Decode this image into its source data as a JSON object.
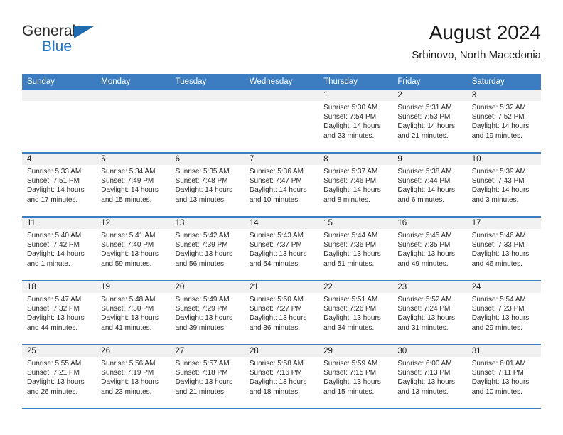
{
  "brand": {
    "word_one": "General",
    "word_two": "Blue",
    "triangle_color": "#1f6cb0",
    "blue_color": "#2277c8"
  },
  "header": {
    "title": "August 2024",
    "subtitle": "Srbinovo, North Macedonia"
  },
  "theme": {
    "header_bar": "#3b7dc0",
    "day_strip": "#f1f1f1",
    "cell_bg": "#ffffff",
    "text": "#2a2a2a"
  },
  "weekdays": [
    "Sunday",
    "Monday",
    "Tuesday",
    "Wednesday",
    "Thursday",
    "Friday",
    "Saturday"
  ],
  "weeks": [
    [
      {
        "day": "",
        "sunrise": "",
        "sunset": "",
        "daylight_1": "",
        "daylight_2": ""
      },
      {
        "day": "",
        "sunrise": "",
        "sunset": "",
        "daylight_1": "",
        "daylight_2": ""
      },
      {
        "day": "",
        "sunrise": "",
        "sunset": "",
        "daylight_1": "",
        "daylight_2": ""
      },
      {
        "day": "",
        "sunrise": "",
        "sunset": "",
        "daylight_1": "",
        "daylight_2": ""
      },
      {
        "day": "1",
        "sunrise": "Sunrise: 5:30 AM",
        "sunset": "Sunset: 7:54 PM",
        "daylight_1": "Daylight: 14 hours",
        "daylight_2": "and 23 minutes."
      },
      {
        "day": "2",
        "sunrise": "Sunrise: 5:31 AM",
        "sunset": "Sunset: 7:53 PM",
        "daylight_1": "Daylight: 14 hours",
        "daylight_2": "and 21 minutes."
      },
      {
        "day": "3",
        "sunrise": "Sunrise: 5:32 AM",
        "sunset": "Sunset: 7:52 PM",
        "daylight_1": "Daylight: 14 hours",
        "daylight_2": "and 19 minutes."
      }
    ],
    [
      {
        "day": "4",
        "sunrise": "Sunrise: 5:33 AM",
        "sunset": "Sunset: 7:51 PM",
        "daylight_1": "Daylight: 14 hours",
        "daylight_2": "and 17 minutes."
      },
      {
        "day": "5",
        "sunrise": "Sunrise: 5:34 AM",
        "sunset": "Sunset: 7:49 PM",
        "daylight_1": "Daylight: 14 hours",
        "daylight_2": "and 15 minutes."
      },
      {
        "day": "6",
        "sunrise": "Sunrise: 5:35 AM",
        "sunset": "Sunset: 7:48 PM",
        "daylight_1": "Daylight: 14 hours",
        "daylight_2": "and 13 minutes."
      },
      {
        "day": "7",
        "sunrise": "Sunrise: 5:36 AM",
        "sunset": "Sunset: 7:47 PM",
        "daylight_1": "Daylight: 14 hours",
        "daylight_2": "and 10 minutes."
      },
      {
        "day": "8",
        "sunrise": "Sunrise: 5:37 AM",
        "sunset": "Sunset: 7:46 PM",
        "daylight_1": "Daylight: 14 hours",
        "daylight_2": "and 8 minutes."
      },
      {
        "day": "9",
        "sunrise": "Sunrise: 5:38 AM",
        "sunset": "Sunset: 7:44 PM",
        "daylight_1": "Daylight: 14 hours",
        "daylight_2": "and 6 minutes."
      },
      {
        "day": "10",
        "sunrise": "Sunrise: 5:39 AM",
        "sunset": "Sunset: 7:43 PM",
        "daylight_1": "Daylight: 14 hours",
        "daylight_2": "and 3 minutes."
      }
    ],
    [
      {
        "day": "11",
        "sunrise": "Sunrise: 5:40 AM",
        "sunset": "Sunset: 7:42 PM",
        "daylight_1": "Daylight: 14 hours",
        "daylight_2": "and 1 minute."
      },
      {
        "day": "12",
        "sunrise": "Sunrise: 5:41 AM",
        "sunset": "Sunset: 7:40 PM",
        "daylight_1": "Daylight: 13 hours",
        "daylight_2": "and 59 minutes."
      },
      {
        "day": "13",
        "sunrise": "Sunrise: 5:42 AM",
        "sunset": "Sunset: 7:39 PM",
        "daylight_1": "Daylight: 13 hours",
        "daylight_2": "and 56 minutes."
      },
      {
        "day": "14",
        "sunrise": "Sunrise: 5:43 AM",
        "sunset": "Sunset: 7:37 PM",
        "daylight_1": "Daylight: 13 hours",
        "daylight_2": "and 54 minutes."
      },
      {
        "day": "15",
        "sunrise": "Sunrise: 5:44 AM",
        "sunset": "Sunset: 7:36 PM",
        "daylight_1": "Daylight: 13 hours",
        "daylight_2": "and 51 minutes."
      },
      {
        "day": "16",
        "sunrise": "Sunrise: 5:45 AM",
        "sunset": "Sunset: 7:35 PM",
        "daylight_1": "Daylight: 13 hours",
        "daylight_2": "and 49 minutes."
      },
      {
        "day": "17",
        "sunrise": "Sunrise: 5:46 AM",
        "sunset": "Sunset: 7:33 PM",
        "daylight_1": "Daylight: 13 hours",
        "daylight_2": "and 46 minutes."
      }
    ],
    [
      {
        "day": "18",
        "sunrise": "Sunrise: 5:47 AM",
        "sunset": "Sunset: 7:32 PM",
        "daylight_1": "Daylight: 13 hours",
        "daylight_2": "and 44 minutes."
      },
      {
        "day": "19",
        "sunrise": "Sunrise: 5:48 AM",
        "sunset": "Sunset: 7:30 PM",
        "daylight_1": "Daylight: 13 hours",
        "daylight_2": "and 41 minutes."
      },
      {
        "day": "20",
        "sunrise": "Sunrise: 5:49 AM",
        "sunset": "Sunset: 7:29 PM",
        "daylight_1": "Daylight: 13 hours",
        "daylight_2": "and 39 minutes."
      },
      {
        "day": "21",
        "sunrise": "Sunrise: 5:50 AM",
        "sunset": "Sunset: 7:27 PM",
        "daylight_1": "Daylight: 13 hours",
        "daylight_2": "and 36 minutes."
      },
      {
        "day": "22",
        "sunrise": "Sunrise: 5:51 AM",
        "sunset": "Sunset: 7:26 PM",
        "daylight_1": "Daylight: 13 hours",
        "daylight_2": "and 34 minutes."
      },
      {
        "day": "23",
        "sunrise": "Sunrise: 5:52 AM",
        "sunset": "Sunset: 7:24 PM",
        "daylight_1": "Daylight: 13 hours",
        "daylight_2": "and 31 minutes."
      },
      {
        "day": "24",
        "sunrise": "Sunrise: 5:54 AM",
        "sunset": "Sunset: 7:23 PM",
        "daylight_1": "Daylight: 13 hours",
        "daylight_2": "and 29 minutes."
      }
    ],
    [
      {
        "day": "25",
        "sunrise": "Sunrise: 5:55 AM",
        "sunset": "Sunset: 7:21 PM",
        "daylight_1": "Daylight: 13 hours",
        "daylight_2": "and 26 minutes."
      },
      {
        "day": "26",
        "sunrise": "Sunrise: 5:56 AM",
        "sunset": "Sunset: 7:19 PM",
        "daylight_1": "Daylight: 13 hours",
        "daylight_2": "and 23 minutes."
      },
      {
        "day": "27",
        "sunrise": "Sunrise: 5:57 AM",
        "sunset": "Sunset: 7:18 PM",
        "daylight_1": "Daylight: 13 hours",
        "daylight_2": "and 21 minutes."
      },
      {
        "day": "28",
        "sunrise": "Sunrise: 5:58 AM",
        "sunset": "Sunset: 7:16 PM",
        "daylight_1": "Daylight: 13 hours",
        "daylight_2": "and 18 minutes."
      },
      {
        "day": "29",
        "sunrise": "Sunrise: 5:59 AM",
        "sunset": "Sunset: 7:15 PM",
        "daylight_1": "Daylight: 13 hours",
        "daylight_2": "and 15 minutes."
      },
      {
        "day": "30",
        "sunrise": "Sunrise: 6:00 AM",
        "sunset": "Sunset: 7:13 PM",
        "daylight_1": "Daylight: 13 hours",
        "daylight_2": "and 13 minutes."
      },
      {
        "day": "31",
        "sunrise": "Sunrise: 6:01 AM",
        "sunset": "Sunset: 7:11 PM",
        "daylight_1": "Daylight: 13 hours",
        "daylight_2": "and 10 minutes."
      }
    ]
  ]
}
